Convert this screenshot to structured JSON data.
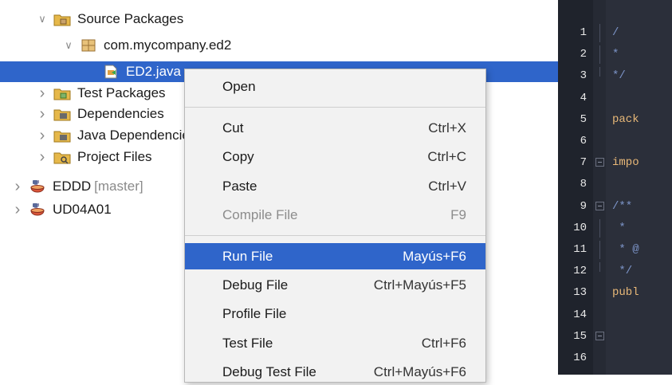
{
  "tree": {
    "items": [
      {
        "name": "tree-item-source-packages",
        "label": "Source Packages",
        "expanded": true,
        "icon": "source-packages-icon",
        "selected": false,
        "branch": ""
      },
      {
        "name": "tree-item-package",
        "label": "com.mycompany.ed2",
        "expanded": true,
        "icon": "package-icon",
        "selected": false,
        "branch": ""
      },
      {
        "name": "tree-item-java-file",
        "label": "ED2.java",
        "expanded": null,
        "icon": "java-file-icon",
        "selected": true,
        "branch": ""
      },
      {
        "name": "tree-item-test-packages",
        "label": "Test Packages",
        "expanded": false,
        "icon": "test-packages-icon",
        "selected": false,
        "branch": ""
      },
      {
        "name": "tree-item-dependencies",
        "label": "Dependencies",
        "expanded": false,
        "icon": "jar-library-icon",
        "selected": false,
        "branch": ""
      },
      {
        "name": "tree-item-java-dependencies",
        "label": "Java Dependencies",
        "expanded": false,
        "icon": "jar-library-icon",
        "selected": false,
        "branch": ""
      },
      {
        "name": "tree-item-project-files",
        "label": "Project Files",
        "expanded": false,
        "icon": "project-files-icon",
        "selected": false,
        "branch": ""
      },
      {
        "name": "tree-item-project-eddd",
        "label": "EDDD",
        "expanded": false,
        "icon": "maven-project-icon",
        "selected": false,
        "branch": "[master]"
      },
      {
        "name": "tree-item-project-ud04a01",
        "label": "UD04A01",
        "expanded": false,
        "icon": "maven-project-icon",
        "selected": false,
        "branch": ""
      }
    ]
  },
  "context_menu": {
    "items": [
      {
        "label": "Open",
        "shortcut": "",
        "disabled": false,
        "highlighted": false,
        "separator_before": false
      },
      {
        "label": "Cut",
        "shortcut": "Ctrl+X",
        "disabled": false,
        "highlighted": false,
        "separator_before": true
      },
      {
        "label": "Copy",
        "shortcut": "Ctrl+C",
        "disabled": false,
        "highlighted": false,
        "separator_before": false
      },
      {
        "label": "Paste",
        "shortcut": "Ctrl+V",
        "disabled": false,
        "highlighted": false,
        "separator_before": false
      },
      {
        "label": "Compile File",
        "shortcut": "F9",
        "disabled": true,
        "highlighted": false,
        "separator_before": false
      },
      {
        "label": "Run File",
        "shortcut": "Mayús+F6",
        "disabled": false,
        "highlighted": true,
        "separator_before": true
      },
      {
        "label": "Debug File",
        "shortcut": "Ctrl+Mayús+F5",
        "disabled": false,
        "highlighted": false,
        "separator_before": false
      },
      {
        "label": "Profile File",
        "shortcut": "",
        "disabled": false,
        "highlighted": false,
        "separator_before": false
      },
      {
        "label": "Test File",
        "shortcut": "Ctrl+F6",
        "disabled": false,
        "highlighted": false,
        "separator_before": false
      },
      {
        "label": "Debug Test File",
        "shortcut": "Ctrl+Mayús+F6",
        "disabled": false,
        "highlighted": false,
        "separator_before": false
      }
    ]
  },
  "editor": {
    "lines": [
      {
        "num": "1",
        "code": "/",
        "cls": "c-cm",
        "fold": "line"
      },
      {
        "num": "2",
        "code": "*",
        "cls": "c-cm",
        "fold": "line"
      },
      {
        "num": "3",
        "code": "*/",
        "cls": "c-cm",
        "fold": "end"
      },
      {
        "num": "4",
        "code": "",
        "cls": "",
        "fold": ""
      },
      {
        "num": "5",
        "code": "pack",
        "cls": "c-kw",
        "fold": ""
      },
      {
        "num": "6",
        "code": "",
        "cls": "",
        "fold": ""
      },
      {
        "num": "7",
        "code": "impo",
        "cls": "c-kw",
        "fold": "box"
      },
      {
        "num": "8",
        "code": "",
        "cls": "",
        "fold": ""
      },
      {
        "num": "9",
        "code": "/**",
        "cls": "c-cm",
        "fold": "box"
      },
      {
        "num": "10",
        "code": " *",
        "cls": "c-cm",
        "fold": "line"
      },
      {
        "num": "11",
        "code": " * @",
        "cls": "c-cm",
        "fold": "line"
      },
      {
        "num": "12",
        "code": " */",
        "cls": "c-cm",
        "fold": "end"
      },
      {
        "num": "13",
        "code": "publ",
        "cls": "c-kw",
        "fold": ""
      },
      {
        "num": "14",
        "code": "",
        "cls": "",
        "fold": ""
      },
      {
        "num": "15",
        "code": "",
        "cls": "",
        "fold": "box"
      },
      {
        "num": "16",
        "code": "",
        "cls": "",
        "fold": ""
      }
    ]
  },
  "colors": {
    "selection": "#2f65ca",
    "editor_bg": "#2b2f3a",
    "menu_bg": "#f2f2f2",
    "keyword": "#e8b878",
    "comment": "#7d95c9"
  }
}
